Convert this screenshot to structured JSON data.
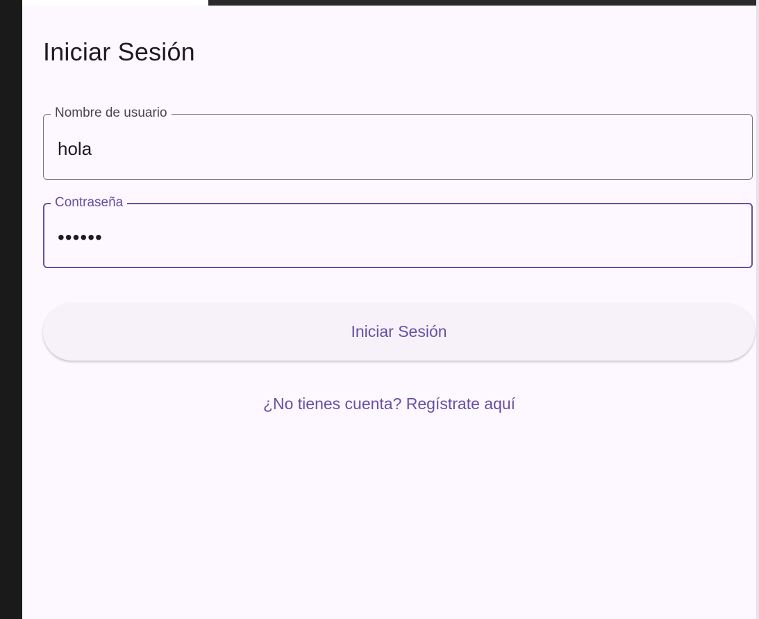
{
  "login": {
    "title": "Iniciar Sesión",
    "username": {
      "label": "Nombre de usuario",
      "value": "hola"
    },
    "password": {
      "label": "Contraseña",
      "value": "••••••"
    },
    "submit_label": "Iniciar Sesión",
    "register_link": "¿No tienes cuenta? Regístrate aquí"
  },
  "colors": {
    "primary": "#6750a4",
    "background": "#fdf7ff",
    "outline": "#79747e"
  }
}
